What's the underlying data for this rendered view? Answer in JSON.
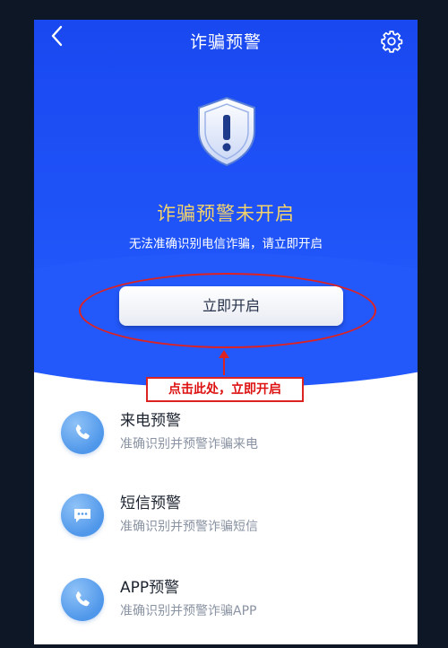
{
  "header": {
    "back_icon": "chevron-left-icon",
    "title": "诈骗预警",
    "settings_icon": "gear-icon"
  },
  "status": {
    "shield_icon": "shield-exclamation-icon",
    "title": "诈骗预警未开启",
    "subtitle": "无法准确识别电信诈骗，请立即开启",
    "button_label": "立即开启"
  },
  "annotation": {
    "callout_text": "点击此处，立即开启"
  },
  "features": [
    {
      "icon": "phone-icon",
      "title": "来电预警",
      "desc": "准确识别并预警诈骗来电"
    },
    {
      "icon": "message-icon",
      "title": "短信预警",
      "desc": "准确识别并预警诈骗短信"
    },
    {
      "icon": "phone-icon",
      "title": "APP预警",
      "desc": "准确识别并预警诈骗APP"
    }
  ],
  "colors": {
    "hero_blue": "#1e52f7",
    "warning_yellow": "#f3d36a",
    "annotation_red": "#dd2222",
    "icon_blue": "#4f97ea"
  }
}
